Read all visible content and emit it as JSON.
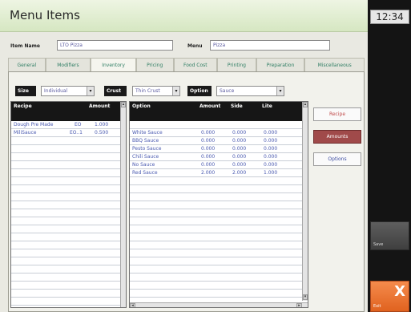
{
  "window": {
    "title": "Menu Items"
  },
  "clock": "12:34",
  "item_name": {
    "label": "Item Name",
    "value": "LTO Pizza"
  },
  "menu": {
    "label": "Menu",
    "value": "Pizza"
  },
  "tabs": [
    {
      "label": "General"
    },
    {
      "label": "Modifiers"
    },
    {
      "label": "Inventory"
    },
    {
      "label": "Pricing"
    },
    {
      "label": "Food Cost"
    },
    {
      "label": "Printing"
    },
    {
      "label": "Preparation"
    },
    {
      "label": "Miscellaneous"
    }
  ],
  "active_tab": "Inventory",
  "filters": {
    "size": {
      "label": "Size",
      "value": "Individual"
    },
    "crust": {
      "label": "Crust",
      "value": "Thin Crust"
    },
    "option": {
      "label": "Option",
      "value": "Sauce"
    }
  },
  "recipe_grid": {
    "headers": {
      "recipe": "Recipe",
      "amount": "Amount"
    },
    "rows": [
      {
        "recipe": "Dough Pre Made",
        "unit": "EO",
        "amount": "1.000"
      },
      {
        "recipe": "MiliSauce",
        "unit": "EO..1",
        "amount": "0.500"
      }
    ]
  },
  "option_grid": {
    "headers": {
      "option": "Option",
      "amount": "Amount",
      "side": "Side",
      "lite": "Lite"
    },
    "rows": [
      {
        "option": "White Sauce",
        "amount": "0.000",
        "side": "0.000",
        "lite": "0.000"
      },
      {
        "option": "BBQ Sauce",
        "amount": "0.000",
        "side": "0.000",
        "lite": "0.000"
      },
      {
        "option": "Pesto Sauce",
        "amount": "0.000",
        "side": "0.000",
        "lite": "0.000"
      },
      {
        "option": "Chili Sauce",
        "amount": "0.000",
        "side": "0.000",
        "lite": "0.000"
      },
      {
        "option": "No Sauce",
        "amount": "0.000",
        "side": "0.000",
        "lite": "0.000"
      },
      {
        "option": "Red Sauce",
        "amount": "2.000",
        "side": "2.000",
        "lite": "1.000"
      }
    ]
  },
  "side_buttons": {
    "recipe": "Recipe",
    "amounts": "Amounts",
    "options": "Options"
  },
  "right_buttons": {
    "gray": "Save",
    "close": "X",
    "close_caption": "Exit"
  },
  "colors": {
    "title_bg": "#d6e7c2",
    "tab_text": "#2f7e64",
    "value_text": "#4a5ab0",
    "active_button": "#a04a4a",
    "close_button": "#e0621f"
  }
}
